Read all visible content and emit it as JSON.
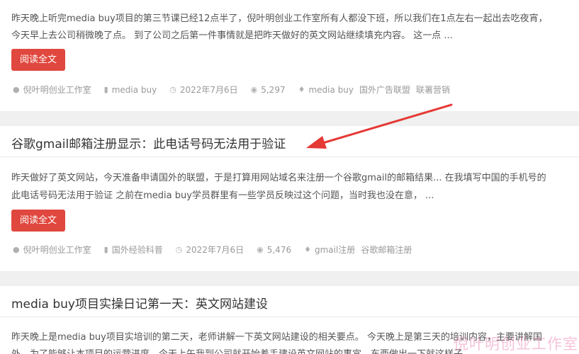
{
  "read_more_label": "阅读全文",
  "posts": [
    {
      "title": "",
      "excerpt_line1": "昨天晚上听完media buy项目的第三节课已经12点半了，倪叶明创业工作室所有人都没下班，所以我们在1点左右一起出去吃夜宵，",
      "excerpt_line2": "今天早上去公司稍微晚了点。 到了公司之后第一件事情就是把昨天做好的英文网站继续填充内容。 这一点 ...",
      "author": "倪叶明创业工作室",
      "category": "media buy",
      "date": "2022年7月6日",
      "views": "5,297",
      "tags": [
        "media buy",
        "国外广告联盟",
        "联署营销"
      ]
    },
    {
      "title": "谷歌gmail邮箱注册显示：此电话号码无法用于验证",
      "excerpt_line1": "昨天做好了英文网站，今天准备申请国外的联盟，于是打算用网站域名来注册一个谷歌gmail的邮箱结果... 在我填写中国的手机号的",
      "excerpt_line2": "此电话号码无法用于验证 之前在media buy学员群里有一些学员反映过这个问题，当时我也没在意，  ...",
      "author": "倪叶明创业工作室",
      "category": "国外经验科普",
      "date": "2022年7月6日",
      "views": "5,476",
      "tags": [
        "gmail注册",
        "谷歌邮箱注册"
      ]
    },
    {
      "title": "media buy项目实操日记第一天：英文网站建设",
      "excerpt_line1": "昨天晚上是media buy项目实培训的第二天，老师讲解一下英文网站建设的相关要点。 今天晚上是第三天的培训内容，主要讲解国",
      "excerpt_line2": "外，为了能够让本项目的运营进度，今天上午我到公司就开始着手建设英文网站的事宜，东西做出一下就这样子。"
    }
  ],
  "icons": {
    "author": "user-icon",
    "category": "folder-icon",
    "date": "clock-icon",
    "views": "eye-icon",
    "tags": "tag-icon"
  },
  "annotation": {
    "arrow_color": "#e53935"
  },
  "watermark": "倪叶明创业工作室"
}
